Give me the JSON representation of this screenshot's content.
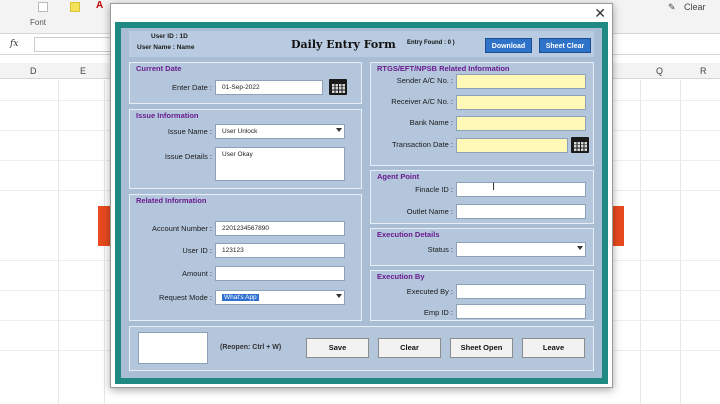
{
  "excel": {
    "ribbon_font_label": "Font",
    "ribbon_right": "Clear",
    "fx": "fx",
    "columns": [
      "D",
      "E",
      "Q",
      "R"
    ]
  },
  "dialog": {
    "close": "✕",
    "header": {
      "user_id": "User ID : 1D",
      "user_name": "User Name : Name",
      "title": "Daily Entry Form",
      "entry_found": "Entry Found : 0 )",
      "download": "Download",
      "sheet_clear": "Sheet Clear"
    },
    "current_date": {
      "title": "Current Date",
      "enter_date_label": "Enter Date :",
      "enter_date_value": "01-Sep-2022"
    },
    "issue_info": {
      "title": "Issue Information",
      "issue_name_label": "Issue Name :",
      "issue_name_value": "User Unlock",
      "issue_details_label": "Issue Details :",
      "issue_details_value": "User Okay"
    },
    "related_info": {
      "title": "Related Information",
      "account_label": "Account Number :",
      "account_value": "2201234567890",
      "userid_label": "User ID :",
      "userid_value": "123123",
      "amount_label": "Amount :",
      "amount_value": "",
      "request_label": "Request Mode :",
      "request_value": "What's App"
    },
    "rtgs": {
      "title": "RTGS/EFT/NPSB Related Information",
      "sender_label": "Sender A/C No. :",
      "receiver_label": "Receiver A/C No. :",
      "bank_label": "Bank Name :",
      "txn_label": "Transaction Date :"
    },
    "agent": {
      "title": "Agent Point",
      "finacle_label": "Finacle ID :",
      "outlet_label": "Outlet Name :"
    },
    "execution_details": {
      "title": "Execution Details",
      "status_label": "Status :"
    },
    "execution_by": {
      "title": "Execution By",
      "executed_label": "Executed By :",
      "emp_label": "Emp ID :"
    },
    "bottom": {
      "reopen": "(Reopen: Ctrl + W)",
      "save": "Save",
      "clear": "Clear",
      "sheet_open": "Sheet Open",
      "leave": "Leave"
    }
  },
  "colors": {
    "frame": "#1e8a82",
    "form_bg": "#a9bdd4",
    "group_title": "#6a1b8f",
    "header_button": "#2e73c8",
    "yellow_field": "#fff8b6",
    "excel_accent": "#e8491e"
  }
}
